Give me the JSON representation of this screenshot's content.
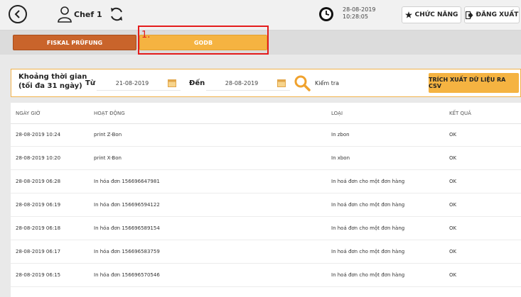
{
  "header": {
    "user_name": "Chef 1",
    "date": "28-08-2019",
    "time": "10:28:05",
    "functions_label": "CHỨC NĂNG",
    "logout_label": "ĐĂNG XUẤT",
    "icons": [
      "back-icon",
      "user-icon",
      "sync-icon",
      "clock-icon",
      "star-icon",
      "logout-icon"
    ]
  },
  "tabs": [
    {
      "label": "FISKAL PRÜFUNG",
      "color": "#c9642b"
    },
    {
      "label": "GODB",
      "color": "#f5b341"
    }
  ],
  "annotation": {
    "label": "1.",
    "color": "#e41c1c"
  },
  "filter": {
    "range_label_line1": "Khoảng thời gian",
    "range_label_line2": "(tối đa 31 ngày)",
    "from_label": "Từ",
    "from_value": "21-08-2019",
    "to_label": "Đến",
    "to_value": "28-08-2019",
    "check_label": "Kiểm tra",
    "export_label": "TRÍCH XUẤT DỮ LIỆU RA CSV"
  },
  "table": {
    "columns": [
      "NGÀY GIỜ",
      "HOẠT ĐỘNG",
      "LOẠI",
      "KẾT QUẢ"
    ],
    "rows": [
      [
        "28-08-2019 10:24",
        "print Z-Bon",
        "In zbon",
        "OK"
      ],
      [
        "28-08-2019 10:20",
        "print X-Bon",
        "In xbon",
        "OK"
      ],
      [
        "28-08-2019 06:28",
        "In hóa đơn 156696647981",
        "In hoá đơn cho một đơn hàng",
        "OK"
      ],
      [
        "28-08-2019 06:19",
        "In hóa đơn 156696594122",
        "In hoá đơn cho một đơn hàng",
        "OK"
      ],
      [
        "28-08-2019 06:18",
        "In hóa đơn 156696589154",
        "In hoá đơn cho một đơn hàng",
        "OK"
      ],
      [
        "28-08-2019 06:17",
        "In hóa đơn 156696583759",
        "In hoá đơn cho một đơn hàng",
        "OK"
      ],
      [
        "28-08-2019 06:15",
        "In hóa đơn 156696570546",
        "In hoá đơn cho một đơn hàng",
        "OK"
      ]
    ]
  },
  "colors": {
    "accent": "#f5b341",
    "accent_dark": "#c9642b",
    "annotation": "#e41c1c"
  }
}
